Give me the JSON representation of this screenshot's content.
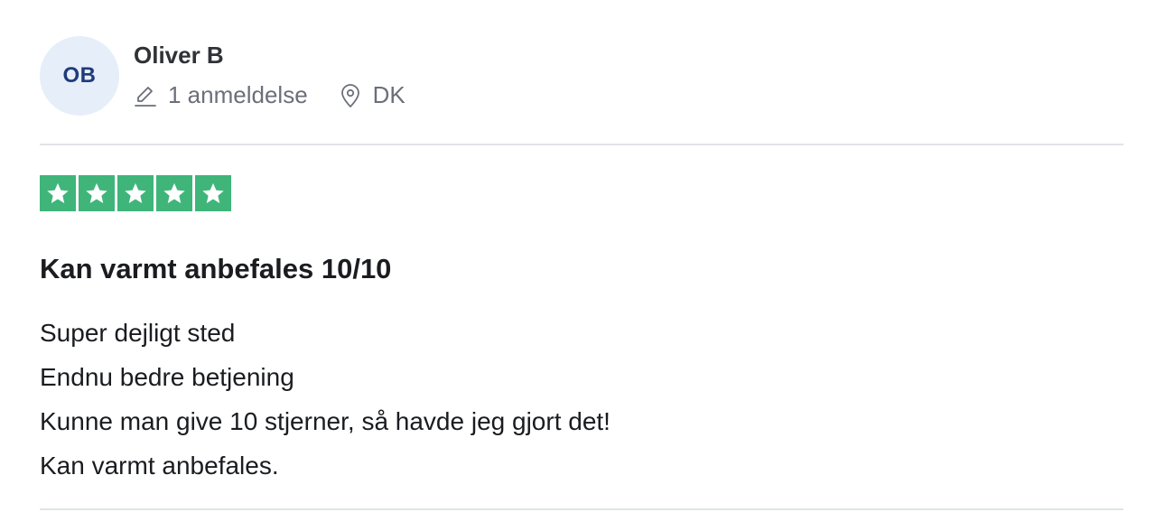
{
  "review": {
    "author": {
      "initials": "OB",
      "name": "Oliver B",
      "reviews_count": "1 anmeldelse",
      "country": "DK"
    },
    "rating": 5,
    "rating_max": 5,
    "star_color": "#3fb57a",
    "title": "Kan varmt anbefales 10/10",
    "body_lines": [
      "Super dejligt sted",
      "Endnu bedre betjening",
      "Kunne man give 10 stjerner, så havde jeg gjort det!",
      "Kan varmt anbefales."
    ]
  }
}
